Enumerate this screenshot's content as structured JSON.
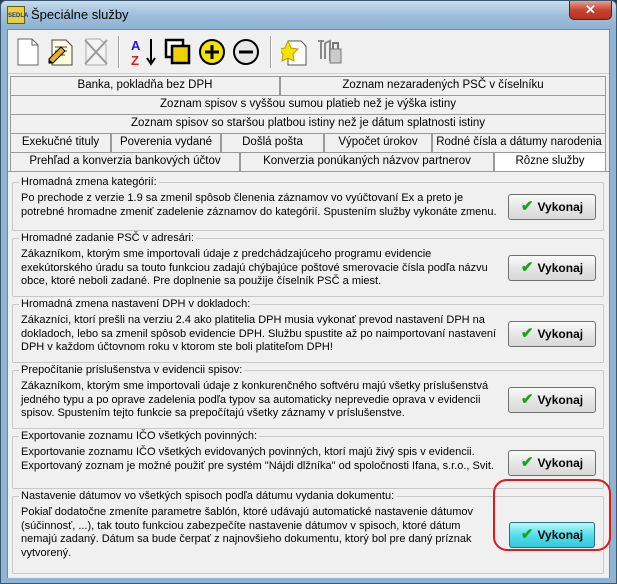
{
  "window": {
    "title": "Špeciálne služby",
    "close_label": "✕",
    "app_icon_text": "SEDLA"
  },
  "toolbar": {
    "buttons": [
      "new-doc-icon",
      "edit-doc-icon",
      "delete-doc-icon",
      "sort-az-icon",
      "copy-icon",
      "add-icon",
      "remove-icon",
      "star-doc-icon",
      "tools-icon"
    ]
  },
  "tabs": {
    "row1": [
      "Banka, pokladňa bez DPH",
      "Zoznam nezaradených PSČ v číselníku"
    ],
    "row2": [
      "Zoznam spisov s vyššou sumou platieb než je výška istiny"
    ],
    "row3": [
      "Zoznam spisov so staršou platbou istiny než je dátum splatnosti istiny"
    ],
    "row4": [
      "Exekučné tituly",
      "Poverenia vydané",
      "Došlá pošta",
      "Výpočet úrokov",
      "Rodné čísla a dátumy narodenia"
    ],
    "row5": [
      "Prehľad a konverzia bankových účtov",
      "Konverzia ponúkaných názvov partnerov",
      "Rôzne služby"
    ]
  },
  "sections": [
    {
      "title": "Hromadná zmena kategórií:",
      "text": "Po prechode z verzie 1.9 sa zmenil spôsob členenia záznamov vo vyúčtovaní Ex a preto je potrebné hromadne zmeniť zadelenie záznamov do kategórií. Spustením služby vykonáte zmenu.",
      "button": "Vykonaj"
    },
    {
      "title": "Hromadné zadanie PSČ v adresári:",
      "text": "Zákazníkom, ktorým sme importovali údaje z predchádzajúceho programu evidencie exekútorského úradu sa touto funkciou zadajú chýbajúce poštové smerovacie čísla podľa názvu obce, ktoré neboli zadané. Pre doplnenie sa použije číselník PSČ a miest.",
      "button": "Vykonaj"
    },
    {
      "title": "Hromadná zmena nastavení DPH v dokladoch:",
      "text": "Zákazníci, ktorí prešli na verziu 2.4 ako platitelia DPH musia vykonať prevod nastavení DPH na dokladoch, lebo sa zmenil spôsob evidencie DPH. Službu spustite až po naimportovaní nastavení DPH v každom účtovnom roku v ktorom ste boli platiteľom DPH!",
      "button": "Vykonaj"
    },
    {
      "title": "Prepočítanie príslušenstva v evidencii spisov:",
      "text": "Zákazníkom, ktorým sme importovali údaje z konkurenčného softvéru majú všetky príslušenstvá jedného typu a po oprave zadelenia podľa typov sa automaticky neprevedie oprava v evidencii spisov. Spustením tejto funkcie sa prepočítajú všetky záznamy v príslušenstve.",
      "button": "Vykonaj"
    },
    {
      "title": "Exportovanie zoznamu IČO všetkých povinných:",
      "text": "Exportovanie zoznamu IČO všetkých evidovaných povinných, ktorí majú živý spis v evidencii. Exportovaný zoznam je možné použiť pre systém \"Nájdi dlžníka\" od spoločnosti Ifana, s.r.o., Svit.",
      "button": "Vykonaj"
    },
    {
      "title": "Nastavenie dátumov vo všetkých spisoch podľa dátumu vydania dokumentu:",
      "text": "Pokiaľ dodatočne zmeníte parametre šablón, ktoré udávajú automatické nastavenie dátumov (súčinnosť, ...), tak touto funkciou zabezpečíte nastavenie dátumov v spisoch, ktoré dátum nemajú zadaný. Dátum sa bude čerpať z najnovšieho dokumentu, ktorý bol pre daný príznak vytvorený.",
      "button": "Vykonaj"
    }
  ],
  "colors": {
    "highlight": "#e01818",
    "check": "#18a418",
    "active_button": "#56e0ea"
  }
}
